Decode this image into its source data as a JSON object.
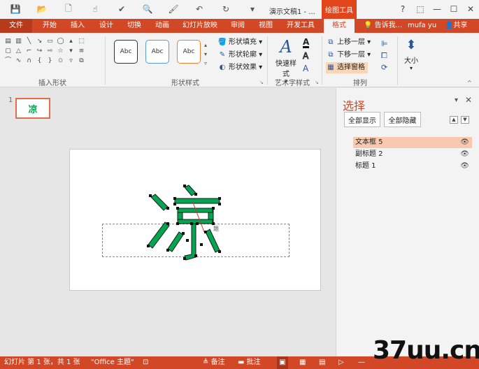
{
  "window": {
    "title": "演示文稿1 - ...",
    "contextual_tab": "绘图工具",
    "controls": [
      "?",
      "⬚",
      "—",
      "☐",
      "✕"
    ]
  },
  "tabs": [
    "文件",
    "开始",
    "插入",
    "设计",
    "切换",
    "动画",
    "幻灯片放映",
    "审阅",
    "视图",
    "开发工具",
    "格式"
  ],
  "tell_me": "告诉我...",
  "user": "mufa yu",
  "share": "共享",
  "ribbon": {
    "insert_shapes_label": "插入形状",
    "shape_styles_label": "形状样式",
    "style_thumbs": [
      "Abc",
      "Abc",
      "Abc"
    ],
    "shape_fill": "形状填充",
    "shape_outline": "形状轮廓",
    "shape_effects": "形状效果",
    "wordart_label": "艺术字样式",
    "quick_styles": "快速样式",
    "arrange_label": "排列",
    "bring_forward": "上移一层",
    "send_backward": "下移一层",
    "selection_pane": "选择窗格",
    "size": "大小"
  },
  "thumbnail": {
    "number": "1",
    "char": "凉"
  },
  "slide": {
    "char": "凉",
    "placeholder_hint": "题"
  },
  "selection_pane": {
    "title": "选择",
    "show_all": "全部显示",
    "hide_all": "全部隐藏",
    "objects": [
      {
        "name": "文本框 5",
        "active": true
      },
      {
        "name": "副标题 2",
        "active": false
      },
      {
        "name": "标题 1",
        "active": false
      }
    ]
  },
  "status": {
    "slide_info": "幻灯片 第 1 张，共 1 张",
    "theme": "\"Office 主题\"",
    "notes": "备注",
    "comments": "批注",
    "watermark": "37uu.cn"
  },
  "colors": {
    "accent": "#d24726",
    "glyph_fill": "#00a650",
    "selected_row": "#f8c9ae"
  }
}
